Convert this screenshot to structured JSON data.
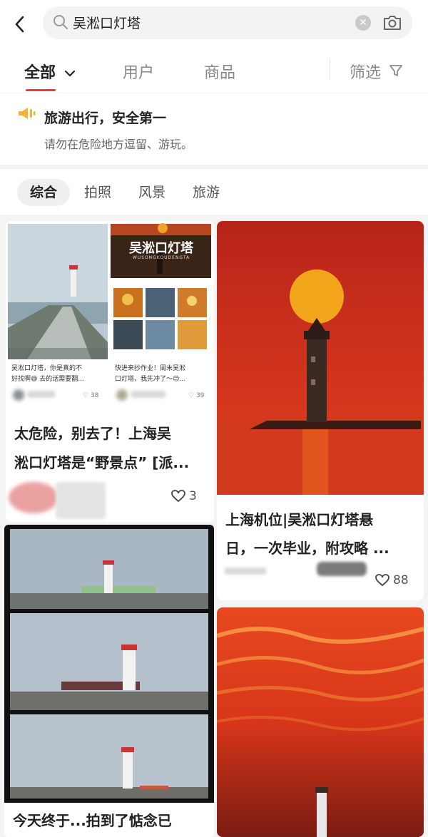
{
  "search": {
    "query": "吴淞口灯塔"
  },
  "tabs": {
    "all": "全部",
    "users": "用户",
    "goods": "商品",
    "filter": "筛选"
  },
  "notice": {
    "title": "旅游出行，安全第一",
    "subtitle": "请勿在危险地方逗留、游玩。"
  },
  "chips": [
    "综合",
    "拍照",
    "风景",
    "旅游"
  ],
  "collage": {
    "banner": "吴淞口灯塔",
    "banner_sub": "WUSONGKOUDENGTA",
    "left_caption_1": "吴淞口灯塔，你是真的不",
    "left_caption_2": "好找啊😅 去的话需要翻...",
    "left_likes": "38",
    "right_caption_1": "快进来抄作业！周末吴淞",
    "right_caption_2": "口灯塔，我先冲了～😊...",
    "right_likes": "39"
  },
  "cards": [
    {
      "title_line1": "太危险，别去了！上海吴",
      "title_line2": "淞口灯塔是“野景点” [派...",
      "likes": "3"
    },
    {
      "title_line1": "上海机位|吴淞口灯塔悬",
      "title_line2": "日，一次毕业，附攻略 ...",
      "likes": "88"
    },
    {
      "title_line1": "今天终于...拍到了惦念已",
      "title_line2": ""
    }
  ],
  "colors": {
    "accent": "#e8393f",
    "sunset_orange": "#e8481f",
    "sea_red": "#c93a22"
  },
  "icons": [
    "back-arrow-icon",
    "search-icon",
    "clear-icon",
    "camera-icon",
    "chevron-down-icon",
    "filter-funnel-icon",
    "megaphone-icon",
    "heart-icon"
  ]
}
